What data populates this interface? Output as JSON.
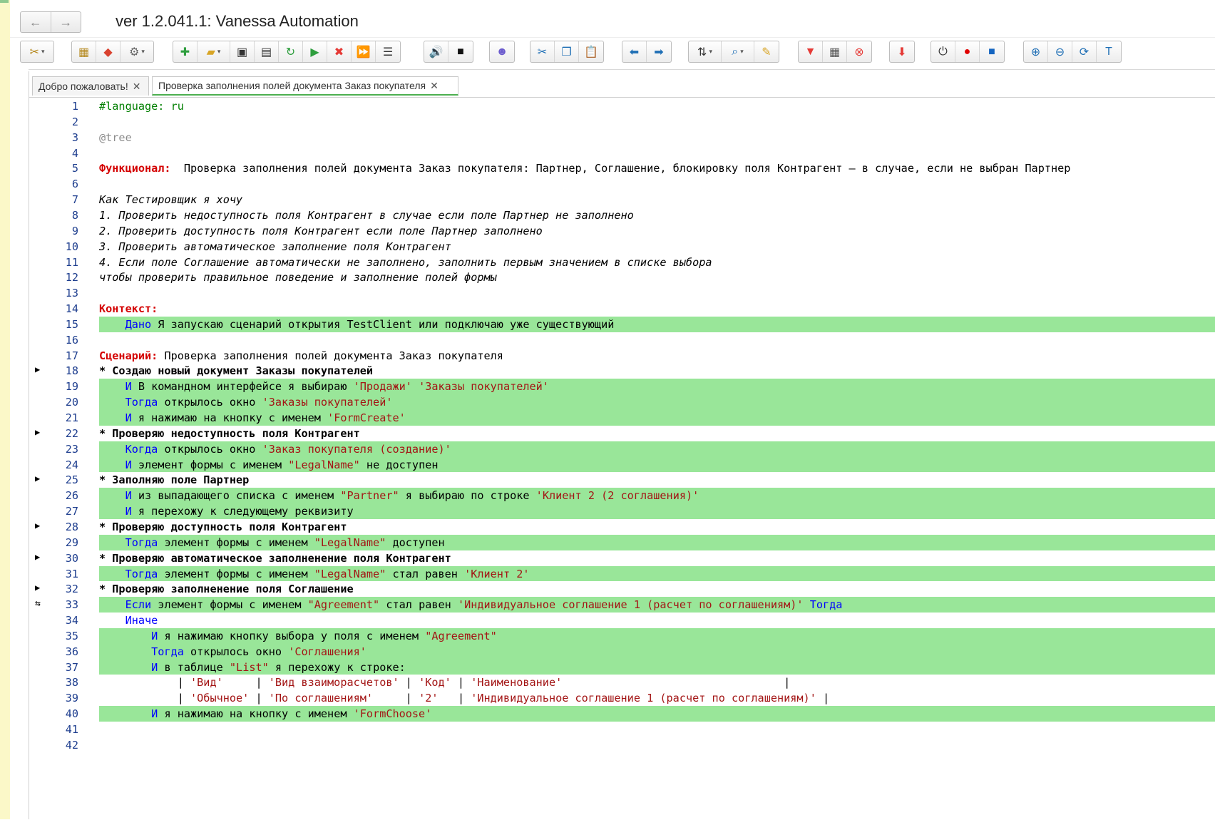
{
  "window": {
    "title": "ver 1.2.041.1: Vanessa Automation",
    "nav_back": "←",
    "nav_forward": "→"
  },
  "toolbar": {
    "groups": [
      [
        {
          "icon": "tools-icon",
          "glyph": "✂",
          "dd": true,
          "color": "#b5891f"
        }
      ],
      [
        {
          "icon": "tree-icon",
          "glyph": "▦",
          "color": "#b5891f"
        },
        {
          "icon": "git-icon",
          "glyph": "◆",
          "color": "#d9412e"
        },
        {
          "icon": "gear-icon",
          "glyph": "⚙",
          "dd": true,
          "color": "#666"
        }
      ],
      [
        {
          "icon": "add-icon",
          "glyph": "✚",
          "color": "#2e9e3e"
        },
        {
          "icon": "open-folder-icon",
          "glyph": "▰",
          "dd": true,
          "color": "#d8a526"
        },
        {
          "icon": "save-icon",
          "glyph": "▣",
          "color": "#333"
        },
        {
          "icon": "save-as-icon",
          "glyph": "▤",
          "color": "#333"
        },
        {
          "icon": "refresh-icon",
          "glyph": "↻",
          "color": "#2e9e3e"
        },
        {
          "icon": "play-icon",
          "glyph": "▶",
          "color": "#2e9e3e"
        },
        {
          "icon": "stop-icon",
          "glyph": "✖",
          "color": "#e53935"
        },
        {
          "icon": "fast-forward-icon",
          "glyph": "⏩",
          "color": "#2e9e3e"
        },
        {
          "icon": "steps-icon",
          "glyph": "☰",
          "color": "#333"
        }
      ],
      [
        {
          "icon": "speaker-icon",
          "glyph": "🔊",
          "color": "#111"
        },
        {
          "icon": "camera-icon",
          "glyph": "■",
          "color": "#111"
        }
      ],
      [
        {
          "icon": "user-icon",
          "glyph": "☻",
          "color": "#6a5acd"
        }
      ],
      [
        {
          "icon": "cut-icon",
          "glyph": "✂",
          "color": "#1f6fb5"
        },
        {
          "icon": "copy-icon",
          "glyph": "❐",
          "color": "#1f6fb5"
        },
        {
          "icon": "paste-icon",
          "glyph": "📋",
          "color": "#1f6fb5"
        }
      ],
      [
        {
          "icon": "arrow-left-icon",
          "glyph": "⬅",
          "color": "#1f6fb5"
        },
        {
          "icon": "arrow-right-icon",
          "glyph": "➡",
          "color": "#1f6fb5"
        }
      ],
      [
        {
          "icon": "sort-icon",
          "glyph": "⇅",
          "dd": true,
          "color": "#333"
        },
        {
          "icon": "search-icon",
          "glyph": "⌕",
          "dd": true,
          "color": "#1f6fb5"
        },
        {
          "icon": "broom-icon",
          "glyph": "✎",
          "color": "#d8a526"
        }
      ],
      [
        {
          "icon": "collapse-icon",
          "glyph": "▼",
          "color": "#e53935"
        },
        {
          "icon": "table-icon",
          "glyph": "▦",
          "color": "#555"
        },
        {
          "icon": "cancel-icon",
          "glyph": "⊗",
          "color": "#e53935"
        }
      ],
      [
        {
          "icon": "download-icon",
          "glyph": "⬇",
          "color": "#e53935"
        }
      ],
      [
        {
          "icon": "power-icon",
          "glyph": "⏻",
          "color": "#333"
        },
        {
          "icon": "record-icon",
          "glyph": "●",
          "color": "#e00000"
        },
        {
          "icon": "stop-square-icon",
          "glyph": "■",
          "color": "#1565c0"
        }
      ],
      [
        {
          "icon": "zoom-in-icon",
          "glyph": "⊕",
          "color": "#1f6fb5"
        },
        {
          "icon": "zoom-out-icon",
          "glyph": "⊖",
          "color": "#1f6fb5"
        },
        {
          "icon": "sync-icon",
          "glyph": "⟳",
          "color": "#1f6fb5"
        },
        {
          "icon": "text-icon",
          "glyph": "T",
          "color": "#1f6fb5"
        }
      ]
    ]
  },
  "tabs": [
    {
      "label": "Добро пожаловать!",
      "close": "✕",
      "active": false
    },
    {
      "label": "Проверка заполнения полей документа Заказ покупателя",
      "close": "✕",
      "active": true
    }
  ],
  "editor": {
    "lines": [
      {
        "n": "1",
        "segs": [
          [
            "c",
            "#language: ru"
          ]
        ]
      },
      {
        "n": "2",
        "segs": []
      },
      {
        "n": "3",
        "segs": [
          [
            "tag",
            "@tree"
          ]
        ]
      },
      {
        "n": "4",
        "segs": []
      },
      {
        "n": "5",
        "segs": [
          [
            "h",
            "Функционал:"
          ],
          [
            "",
            "  Проверка заполнения полей документа Заказ покупателя: Партнер, Соглашение, блокировку поля Контрагент – в случае, если не выбран Партнер"
          ]
        ]
      },
      {
        "n": "6",
        "segs": []
      },
      {
        "n": "7",
        "segs": [
          [
            "i",
            "Как Тестировщик я хочу"
          ]
        ]
      },
      {
        "n": "8",
        "segs": [
          [
            "i",
            "1. Проверить недоступность поля Контрагент в случае если поле Партнер не заполнено"
          ]
        ]
      },
      {
        "n": "9",
        "segs": [
          [
            "i",
            "2. Проверить доступность поля Контрагент если поле Партнер заполнено"
          ]
        ]
      },
      {
        "n": "10",
        "segs": [
          [
            "i",
            "3. Проверить автоматическое заполнение поля Контрагент"
          ]
        ]
      },
      {
        "n": "11",
        "segs": [
          [
            "i",
            "4. Если поле Соглашение автоматически не заполнено, заполнить первым значением в списке выбора"
          ]
        ]
      },
      {
        "n": "12",
        "segs": [
          [
            "i",
            "чтобы проверить правильное поведение и заполнение полей формы"
          ]
        ]
      },
      {
        "n": "13",
        "segs": []
      },
      {
        "n": "14",
        "segs": [
          [
            "h",
            "Контекст:"
          ]
        ]
      },
      {
        "n": "15",
        "hl": true,
        "segs": [
          [
            "",
            "    "
          ],
          [
            "k",
            "Дано"
          ],
          [
            "",
            " Я запускаю сценарий открытия TestClient или подключаю уже существующий"
          ]
        ]
      },
      {
        "n": "16",
        "segs": []
      },
      {
        "n": "17",
        "segs": [
          [
            "h",
            "Сценарий:"
          ],
          [
            "",
            " Проверка заполнения полей документа Заказ покупателя"
          ]
        ]
      },
      {
        "n": "18",
        "fold": true,
        "segs": [
          [
            "b",
            "* Создаю новый документ Заказы покупателей"
          ]
        ]
      },
      {
        "n": "19",
        "hl": true,
        "segs": [
          [
            "",
            "    "
          ],
          [
            "k",
            "И"
          ],
          [
            "",
            " В командном интерфейсе я выбираю "
          ],
          [
            "s",
            "'Продажи'"
          ],
          [
            "",
            " "
          ],
          [
            "s",
            "'Заказы покупателей'"
          ]
        ]
      },
      {
        "n": "20",
        "hl": true,
        "segs": [
          [
            "",
            "    "
          ],
          [
            "k",
            "Тогда"
          ],
          [
            "",
            " открылось окно "
          ],
          [
            "s",
            "'Заказы покупателей'"
          ]
        ]
      },
      {
        "n": "21",
        "hl": true,
        "segs": [
          [
            "",
            "    "
          ],
          [
            "k",
            "И"
          ],
          [
            "",
            " я нажимаю на кнопку с именем "
          ],
          [
            "s",
            "'FormCreate'"
          ]
        ]
      },
      {
        "n": "22",
        "fold": true,
        "segs": [
          [
            "b",
            "* Проверяю недоступность поля Контрагент"
          ]
        ]
      },
      {
        "n": "23",
        "hl": true,
        "segs": [
          [
            "",
            "    "
          ],
          [
            "k",
            "Когда"
          ],
          [
            "",
            " открылось окно "
          ],
          [
            "s",
            "'Заказ покупателя (создание)'"
          ]
        ]
      },
      {
        "n": "24",
        "hl": true,
        "segs": [
          [
            "",
            "    "
          ],
          [
            "k",
            "И"
          ],
          [
            "",
            " элемент формы с именем "
          ],
          [
            "s",
            "\"LegalName\""
          ],
          [
            "",
            " не доступен"
          ]
        ]
      },
      {
        "n": "25",
        "fold": true,
        "segs": [
          [
            "b",
            "* Заполняю поле Партнер"
          ]
        ]
      },
      {
        "n": "26",
        "hl": true,
        "segs": [
          [
            "",
            "    "
          ],
          [
            "k",
            "И"
          ],
          [
            "",
            " из выпадающего списка с именем "
          ],
          [
            "s",
            "\"Partner\""
          ],
          [
            "",
            " я выбираю по строке "
          ],
          [
            "s",
            "'Клиент 2 (2 соглашения)'"
          ]
        ]
      },
      {
        "n": "27",
        "hl": true,
        "segs": [
          [
            "",
            "    "
          ],
          [
            "k",
            "И"
          ],
          [
            "",
            " я перехожу к следующему реквизиту"
          ]
        ]
      },
      {
        "n": "28",
        "fold": true,
        "segs": [
          [
            "b",
            "* Проверяю доступность поля Контрагент"
          ]
        ]
      },
      {
        "n": "29",
        "hl": true,
        "segs": [
          [
            "",
            "    "
          ],
          [
            "k",
            "Тогда"
          ],
          [
            "",
            " элемент формы с именем "
          ],
          [
            "s",
            "\"LegalName\""
          ],
          [
            "",
            " доступен"
          ]
        ]
      },
      {
        "n": "30",
        "fold": true,
        "segs": [
          [
            "b",
            "* Проверяю автоматическое заполненение поля Контрагент"
          ]
        ]
      },
      {
        "n": "31",
        "hl": true,
        "segs": [
          [
            "",
            "    "
          ],
          [
            "k",
            "Тогда"
          ],
          [
            "",
            " элемент формы с именем "
          ],
          [
            "s",
            "\"LegalName\""
          ],
          [
            "",
            " стал равен "
          ],
          [
            "s",
            "'Клиент 2'"
          ]
        ]
      },
      {
        "n": "32",
        "fold": true,
        "segs": [
          [
            "b",
            "* Проверяю заполненение поля Соглашение"
          ]
        ]
      },
      {
        "n": "33",
        "hl": true,
        "branch": true,
        "segs": [
          [
            "",
            "    "
          ],
          [
            "k",
            "Если"
          ],
          [
            "",
            " элемент формы с именем "
          ],
          [
            "s",
            "\"Agreement\""
          ],
          [
            "",
            " стал равен "
          ],
          [
            "s",
            "'Индивидуальное соглашение 1 (расчет по соглашениям)'"
          ],
          [
            "",
            " "
          ],
          [
            "k",
            "Тогда"
          ]
        ]
      },
      {
        "n": "34",
        "segs": [
          [
            "",
            "    "
          ],
          [
            "k",
            "Иначе"
          ]
        ]
      },
      {
        "n": "35",
        "hl": true,
        "segs": [
          [
            "",
            "        "
          ],
          [
            "k",
            "И"
          ],
          [
            "",
            " я нажимаю кнопку выбора у поля с именем "
          ],
          [
            "s",
            "\"Agreement\""
          ]
        ]
      },
      {
        "n": "36",
        "hl": true,
        "segs": [
          [
            "",
            "        "
          ],
          [
            "k",
            "Тогда"
          ],
          [
            "",
            " открылось окно "
          ],
          [
            "s",
            "'Соглашения'"
          ]
        ]
      },
      {
        "n": "37",
        "hl": true,
        "segs": [
          [
            "",
            "        "
          ],
          [
            "k",
            "И"
          ],
          [
            "",
            " в таблице "
          ],
          [
            "s",
            "\"List\""
          ],
          [
            "",
            " я перехожу к строке:"
          ]
        ]
      },
      {
        "n": "38",
        "segs": [
          [
            "",
            "            | "
          ],
          [
            "s",
            "'Вид'"
          ],
          [
            "",
            "     | "
          ],
          [
            "s",
            "'Вид взаиморасчетов'"
          ],
          [
            "",
            " | "
          ],
          [
            "s",
            "'Код'"
          ],
          [
            "",
            " | "
          ],
          [
            "s",
            "'Наименование'"
          ],
          [
            "",
            "                                  |"
          ]
        ]
      },
      {
        "n": "39",
        "segs": [
          [
            "",
            "            | "
          ],
          [
            "s",
            "'Обычное'"
          ],
          [
            "",
            " | "
          ],
          [
            "s",
            "'По соглашениям'"
          ],
          [
            "",
            "     | "
          ],
          [
            "s",
            "'2'"
          ],
          [
            "",
            "   | "
          ],
          [
            "s",
            "'Индивидуальное соглашение 1 (расчет по соглашениям)'"
          ],
          [
            "",
            " |"
          ]
        ]
      },
      {
        "n": "40",
        "hl": true,
        "segs": [
          [
            "",
            "        "
          ],
          [
            "k",
            "И"
          ],
          [
            "",
            " я нажимаю на кнопку с именем "
          ],
          [
            "s",
            "'FormChoose'"
          ]
        ]
      },
      {
        "n": "41",
        "segs": []
      },
      {
        "n": "42",
        "segs": []
      }
    ]
  }
}
